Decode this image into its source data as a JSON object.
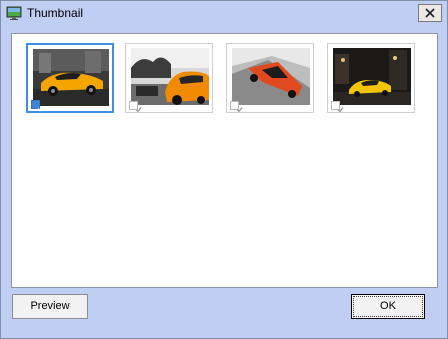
{
  "window": {
    "title": "Thumbnail",
    "title_icon": "monitor-icon",
    "close_icon": "close-icon",
    "background": "#c0cef3"
  },
  "thumbnails": [
    {
      "name": "orange-lamborghini-front",
      "checked": true,
      "selected": true
    },
    {
      "name": "orange-lamborghini-rear",
      "checked": true,
      "selected": false
    },
    {
      "name": "red-lamborghini-tilted",
      "checked": true,
      "selected": false
    },
    {
      "name": "yellow-lamborghini-night",
      "checked": true,
      "selected": false
    }
  ],
  "buttons": {
    "preview_label": "Preview",
    "ok_label": "OK"
  },
  "colors": {
    "selection_border": "#3d8ee8",
    "panel_bg": "#ffffff"
  }
}
